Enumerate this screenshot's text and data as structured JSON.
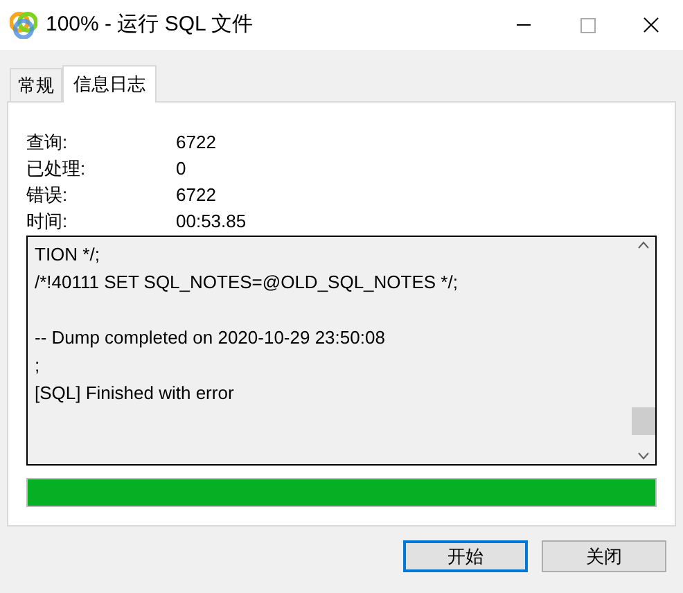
{
  "window": {
    "title": "100% - 运行 SQL 文件"
  },
  "tabs": [
    {
      "label": "常规",
      "selected": false
    },
    {
      "label": "信息日志",
      "selected": true
    }
  ],
  "stats": [
    {
      "label": "查询:",
      "value": "6722"
    },
    {
      "label": "已处理:",
      "value": "0"
    },
    {
      "label": "错误:",
      "value": "6722"
    },
    {
      "label": "时间:",
      "value": "00:53.85"
    }
  ],
  "log": [
    {
      "lines": [
        "TION */;",
        "/*!40111 SET SQL_NOTES=@OLD_SQL_NOTES */;"
      ]
    },
    {
      "lines": [
        "-- Dump completed on 2020-10-29 23:50:08",
        ";",
        "[SQL] Finished with error"
      ]
    }
  ],
  "progress": {
    "level": 1
  },
  "buttons": [
    {
      "label": "开始",
      "selected": true
    },
    {
      "label": "关闭",
      "selected": false
    }
  ]
}
